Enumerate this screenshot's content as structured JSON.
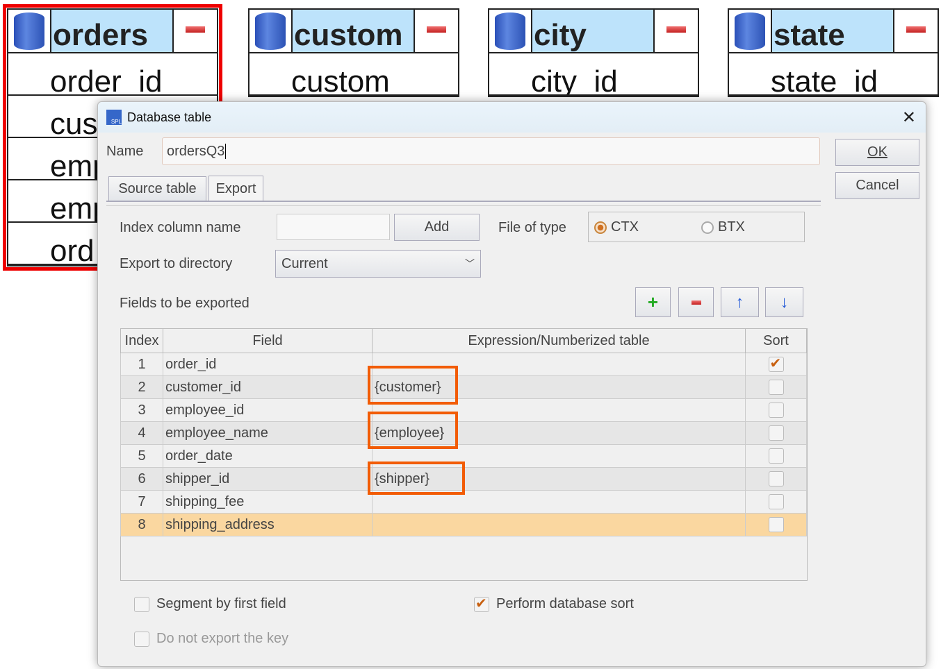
{
  "tables": [
    {
      "name": "orders",
      "rows": [
        "order_id",
        "cus",
        "emp",
        "emp",
        "ord"
      ]
    },
    {
      "name": "custom",
      "rows": [
        "custom"
      ]
    },
    {
      "name": "city",
      "rows": [
        "city_id"
      ]
    },
    {
      "name": "state",
      "rows": [
        "state_id"
      ]
    }
  ],
  "dialog": {
    "title": "Database table",
    "name_label": "Name",
    "name_value": "ordersQ3",
    "ok": "OK",
    "cancel": "Cancel",
    "tabs": [
      "Source table",
      "Export"
    ],
    "index_label": "Index column name",
    "index_value": "",
    "add": "Add",
    "file_type_label": "File of type",
    "file_types": [
      "CTX",
      "BTX"
    ],
    "file_type_selected": "CTX",
    "dir_label": "Export to directory",
    "dir_value": "Current",
    "fields_label": "Fields to be exported",
    "columns": [
      "Index",
      "Field",
      "Expression/Numberized table",
      "Sort"
    ],
    "rows": [
      {
        "i": "1",
        "f": "order_id",
        "e": "",
        "s": true
      },
      {
        "i": "2",
        "f": "customer_id",
        "e": "{customer}",
        "s": false
      },
      {
        "i": "3",
        "f": "employee_id",
        "e": "",
        "s": false
      },
      {
        "i": "4",
        "f": "employee_name",
        "e": "{employee}",
        "s": false
      },
      {
        "i": "5",
        "f": "order_date",
        "e": "",
        "s": false
      },
      {
        "i": "6",
        "f": "shipper_id",
        "e": "{shipper}",
        "s": false
      },
      {
        "i": "7",
        "f": "shipping_fee",
        "e": "",
        "s": false
      },
      {
        "i": "8",
        "f": "shipping_address",
        "e": "",
        "s": false
      }
    ],
    "segment_label": "Segment by first field",
    "segment_checked": false,
    "dbsort_label": "Perform database sort",
    "dbsort_checked": true,
    "nokey_label": "Do not export the key",
    "nokey_checked": false
  }
}
